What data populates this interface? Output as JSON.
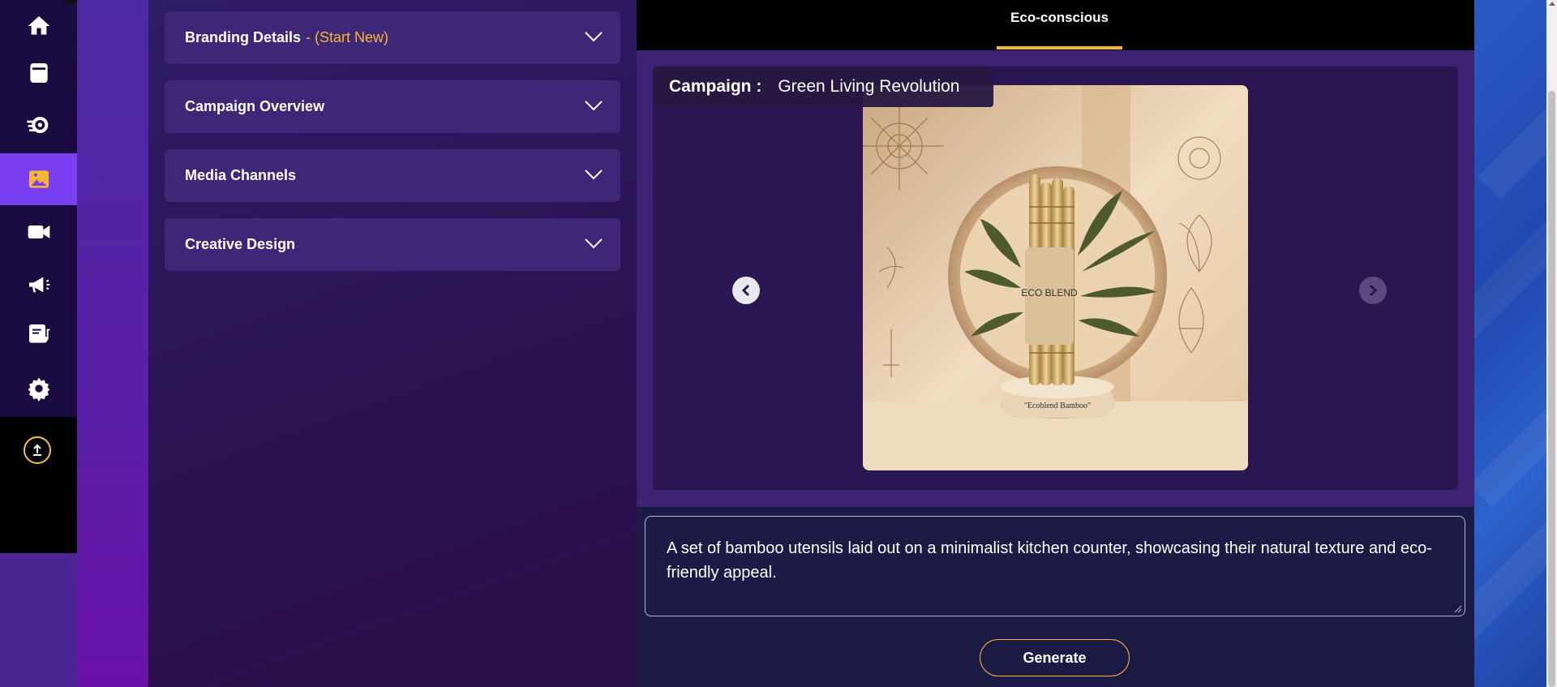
{
  "sidebar": {
    "items": [
      {
        "icon": "home-icon"
      },
      {
        "icon": "document-icon"
      },
      {
        "icon": "gear-arrows-icon"
      },
      {
        "icon": "image-icon",
        "active": true
      },
      {
        "icon": "video-icon"
      },
      {
        "icon": "megaphone-icon"
      },
      {
        "icon": "content-music-icon"
      },
      {
        "icon": "settings-icon"
      }
    ],
    "upload_icon": "upload-icon"
  },
  "accordion": {
    "items": [
      {
        "label": "Branding Details",
        "accent": "- (Start New)"
      },
      {
        "label": "Campaign Overview"
      },
      {
        "label": "Media Channels"
      },
      {
        "label": "Creative Design"
      }
    ]
  },
  "tabs": {
    "active_label": "Eco-conscious"
  },
  "viewer": {
    "campaign_label": "Campaign :",
    "campaign_name": "Green Living Revolution",
    "image_texts": {
      "brand": "ECO BLEND",
      "base": "\"Ecoblend Bamboo\""
    }
  },
  "prompt": {
    "text": "A set of bamboo utensils laid out on a minimalist kitchen counter, showcasing their natural texture and eco-friendly appeal."
  },
  "generate_label": "Generate",
  "colors": {
    "accent": "#f5b535",
    "active_nav": "#7b3ff2",
    "panel_bg": "#3f2777"
  }
}
